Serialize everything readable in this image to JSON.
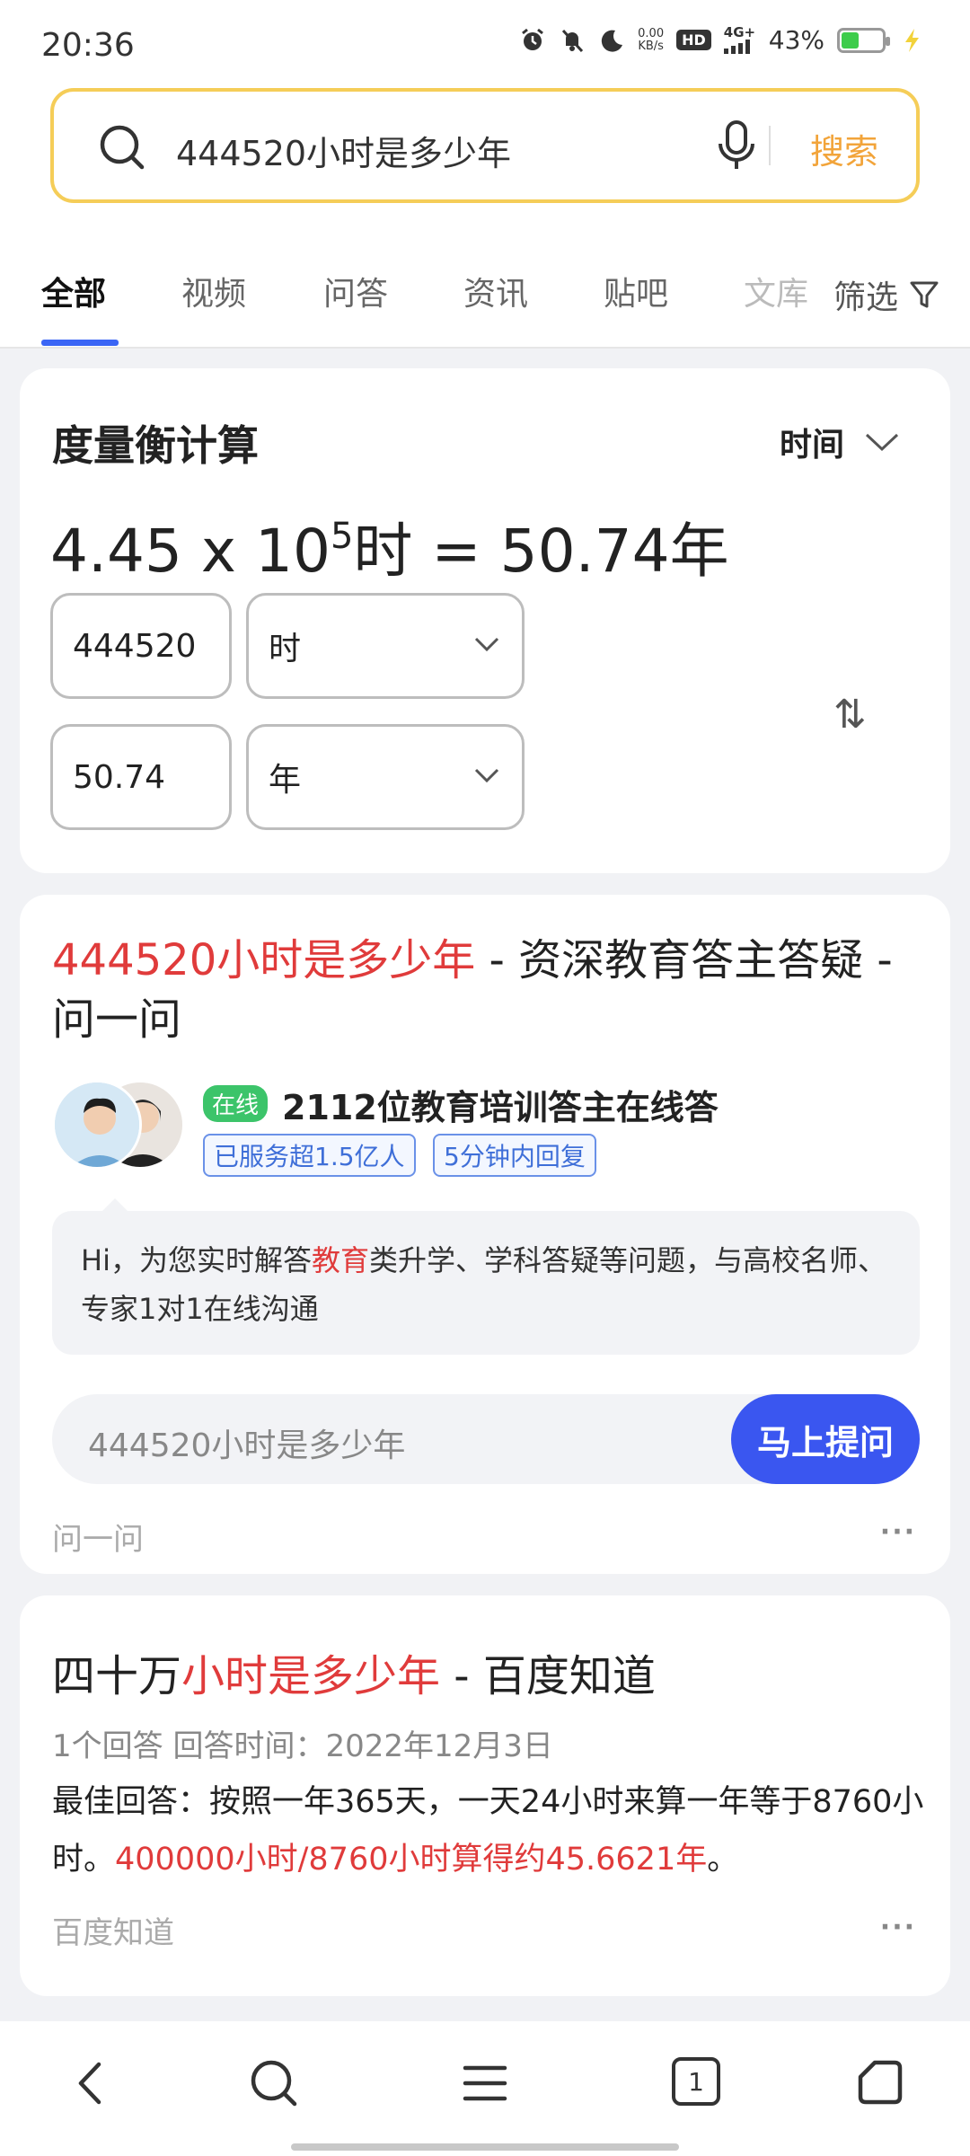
{
  "status_bar": {
    "time": "20:36",
    "net_speed_value": "0.00",
    "net_speed_unit": "KB/s",
    "hd": "HD",
    "network": "4G+",
    "battery_percent": "43%",
    "battery_level": 0.43,
    "icons": [
      "alarm-icon",
      "mute-icon",
      "moon-icon",
      "signal-icon",
      "battery-icon",
      "charging-icon"
    ]
  },
  "search": {
    "query": "444520小时是多少年",
    "button_label": "搜索",
    "accent_color": "#f5cd58"
  },
  "tabs": {
    "items": [
      "全部",
      "视频",
      "问答",
      "资讯",
      "贴吧",
      "文库"
    ],
    "active": "全部",
    "filter_label": "筛选"
  },
  "converter": {
    "title": "度量衡计算",
    "category": "时间",
    "formula_mantissa": "4.45 x 10",
    "formula_exponent": "5",
    "formula_rest": "时 = 50.74年",
    "input_value": "444520",
    "input_unit": "时",
    "output_value": "50.74",
    "output_unit": "年",
    "swap_symbol": "⇅"
  },
  "qa_card": {
    "title_highlight": "444520小时是多少年",
    "title_rest": " - 资深教育答主答疑 - 问一问",
    "online_badge": "在线",
    "expert_text": "2112位教育培训答主在线答",
    "badge_served": "已服务超1.5亿人",
    "badge_reply": "5分钟内回复",
    "bubble_prefix": "Hi，为您实时解答",
    "bubble_highlight": "教育",
    "bubble_suffix": "类升学、学科答疑等问题，与高校名师、专家1对1在线沟通",
    "ask_placeholder": "444520小时是多少年",
    "ask_button": "马上提问",
    "source": "问一问",
    "more": "···"
  },
  "zhidao_card": {
    "title_prefix": "四十万",
    "title_highlight": "小时是多少年",
    "title_suffix": " - 百度知道",
    "meta": "1个回答   回答时间：2022年12月3日",
    "answer_prefix": "最佳回答：按照一年365天，一天24小时来算一年等于8760小时。",
    "answer_highlight": "400000小时/8760小时算得约45.6621年",
    "answer_suffix": "。",
    "source": "百度知道",
    "more": "···"
  },
  "bottom_nav": {
    "tab_count": "1"
  }
}
